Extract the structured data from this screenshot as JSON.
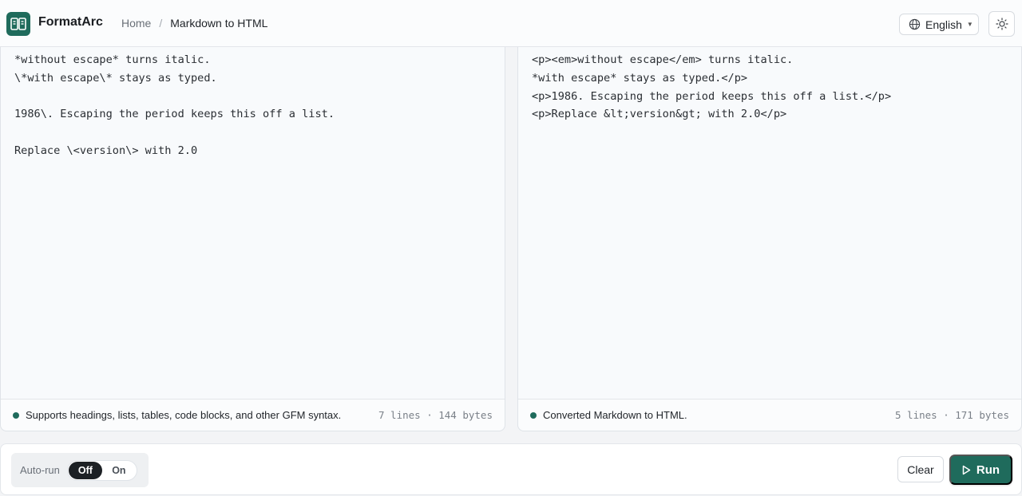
{
  "app": {
    "brand": "FormatArc",
    "accent": "#1f6b5c",
    "logo_icon": "split-document-icon"
  },
  "breadcrumb": {
    "home": "Home",
    "separator": "/",
    "current": "Markdown to HTML"
  },
  "header": {
    "language_label": "English",
    "language_icon": "globe-icon",
    "theme_icon": "sun-icon"
  },
  "input_panel": {
    "content": "*without escape* turns italic.\n\\*with escape\\* stays as typed.\n\n1986\\. Escaping the period keeps this off a list.\n\nReplace \\<version\\> with 2.0",
    "status_text": "Supports headings, lists, tables, code blocks, and other GFM syntax.",
    "stats": "7 lines · 144 bytes"
  },
  "output_panel": {
    "content": "<p><em>without escape</em> turns italic.\n*with escape* stays as typed.</p>\n<p>1986. Escaping the period keeps this off a list.</p>\n<p>Replace &lt;version&gt; with 2.0</p>",
    "status_text": "Converted Markdown to HTML.",
    "stats": "5 lines · 171 bytes"
  },
  "bottom_bar": {
    "autorun_label": "Auto-run",
    "toggle_off": "Off",
    "toggle_on": "On",
    "toggle_selected": "Off",
    "clear_label": "Clear",
    "run_label": "Run"
  }
}
